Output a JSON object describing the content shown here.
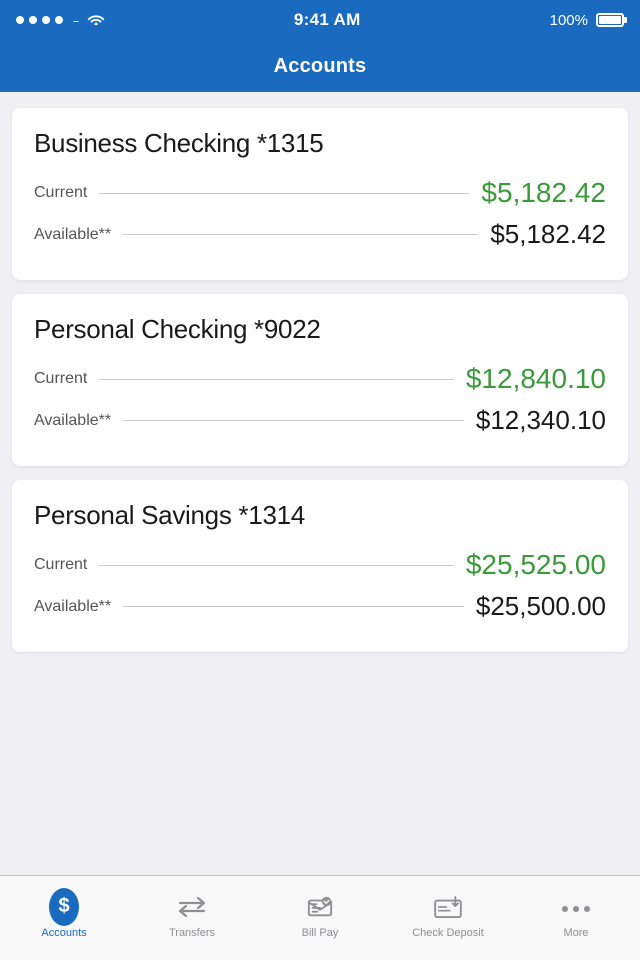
{
  "statusBar": {
    "time": "9:41 AM",
    "battery": "100%"
  },
  "header": {
    "title": "Accounts"
  },
  "accounts": [
    {
      "name": "Business Checking *1315",
      "current": "$5,182.42",
      "available": "$5,182.42"
    },
    {
      "name": "Personal Checking *9022",
      "current": "$12,840.10",
      "available": "$12,340.10"
    },
    {
      "name": "Personal Savings *1314",
      "current": "$25,525.00",
      "available": "$25,500.00"
    }
  ],
  "tabs": [
    {
      "id": "accounts",
      "label": "Accounts",
      "active": true
    },
    {
      "id": "transfers",
      "label": "Transfers",
      "active": false
    },
    {
      "id": "billpay",
      "label": "Bill Pay",
      "active": false
    },
    {
      "id": "checkdeposit",
      "label": "Check Deposit",
      "active": false
    },
    {
      "id": "more",
      "label": "More",
      "active": false
    }
  ],
  "balanceLabels": {
    "current": "Current",
    "available": "Available**"
  }
}
